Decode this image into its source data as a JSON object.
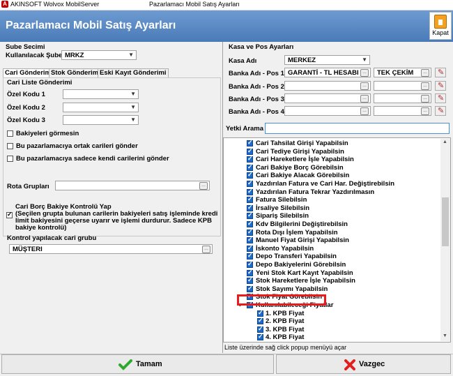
{
  "window": {
    "app_title": "AKINSOFT Wolvox MobilServer",
    "title": "Pazarlamacı Mobil Satış Ayarları"
  },
  "header": {
    "title": "Pazarlamacı Mobil Satış Ayarları",
    "close_label": "Kapat"
  },
  "left": {
    "sube_section": "Sube Secimi",
    "sube_label": "Kullanılacak Şube",
    "sube_value": "MRKZ",
    "tabs": [
      "Cari Gönderimi",
      "Stok Gönderimi",
      "Eski Kayıt Gönderimi"
    ],
    "cari_section": "Cari Liste Gönderimi",
    "ozel_kodu_1": "Özel Kodu 1",
    "ozel_kodu_2": "Özel Kodu 2",
    "ozel_kodu_3": "Özel Kodu 3",
    "cb_bakiye": "Bakiyeleri görmesin",
    "cb_ortak": "Bu pazarlamacıya ortak carileri gönder",
    "cb_kendi": "Bu pazarlamacıya sadece kendi carilerini gönder",
    "rota_label": "Rota Grupları",
    "borc_line1": "Cari Borç Bakiye Kontrolü Yap",
    "borc_line2": "(Seçilen grupta bulunan carilerin bakiyeleri satış işleminde kredi",
    "borc_line3": "limit bakiyesini geçerse uyarır ve işlemi durdurur. Sadece KPB",
    "borc_line4": "bakiye kontrolü)",
    "kontrol_label": "Kontrol yapılacak cari grubu",
    "kontrol_value": "MÜŞTERI"
  },
  "right": {
    "kasa_section": "Kasa ve Pos Ayarları",
    "kasa_label": "Kasa Adı",
    "kasa_value": "MERKEZ",
    "banka_labels": [
      "Banka Adı - Pos 1",
      "Banka Adı - Pos 2",
      "Banka Adı - Pos 3",
      "Banka Adı - Pos 4"
    ],
    "banka_1_value": "GARANTİ - TL HESABI -",
    "banka_1_second": "TEK ÇEKİM",
    "yetki_label": "Yetki Arama",
    "yetki_value": "",
    "permissions": [
      "Cari Tahsilat Girişi Yapabilsin",
      "Cari Tediye Girişi Yapabilsin",
      "Cari Hareketlere İşle Yapabilsin",
      "Cari Bakiye Borç Görebilsin",
      "Cari Bakiye Alacak Görebilsin",
      "Yazdırılan Fatura ve Cari Har. Değiştirebilsin",
      "Yazdırılan Fatura Tekrar Yazdırılmasın",
      "Fatura Silebilsin",
      "İrsaliye Silebilsin",
      "Sipariş Silebilsin",
      "Kdv Bilgilerini Değiştirebilsin",
      "Rota Dışı İşlem Yapabilsin",
      "Manuel Fiyat Girişi Yapabilsin",
      "İskonto Yapabilsin",
      "Depo Transferi Yapabilsin",
      "Depo Bakiyelerini Görebilsin",
      "Yeni Stok Kart Kayıt Yapabilsin",
      "Stok Hareketlere İşle Yapabilsin",
      "Stok Sayımı Yapabilsin",
      "Stok Fiyat Görebilsin"
    ],
    "price_group": "Kullanılabileceği Fiyatlar",
    "prices": [
      "1. KPB Fiyat",
      "2. KPB Fiyat",
      "3. KPB Fiyat",
      "4. KPB Fiyat"
    ],
    "hint": "Liste üzerinde sağ click popup menüyü açar"
  },
  "footer": {
    "ok_label": "Tamam",
    "cancel_label": "Vazgec"
  }
}
